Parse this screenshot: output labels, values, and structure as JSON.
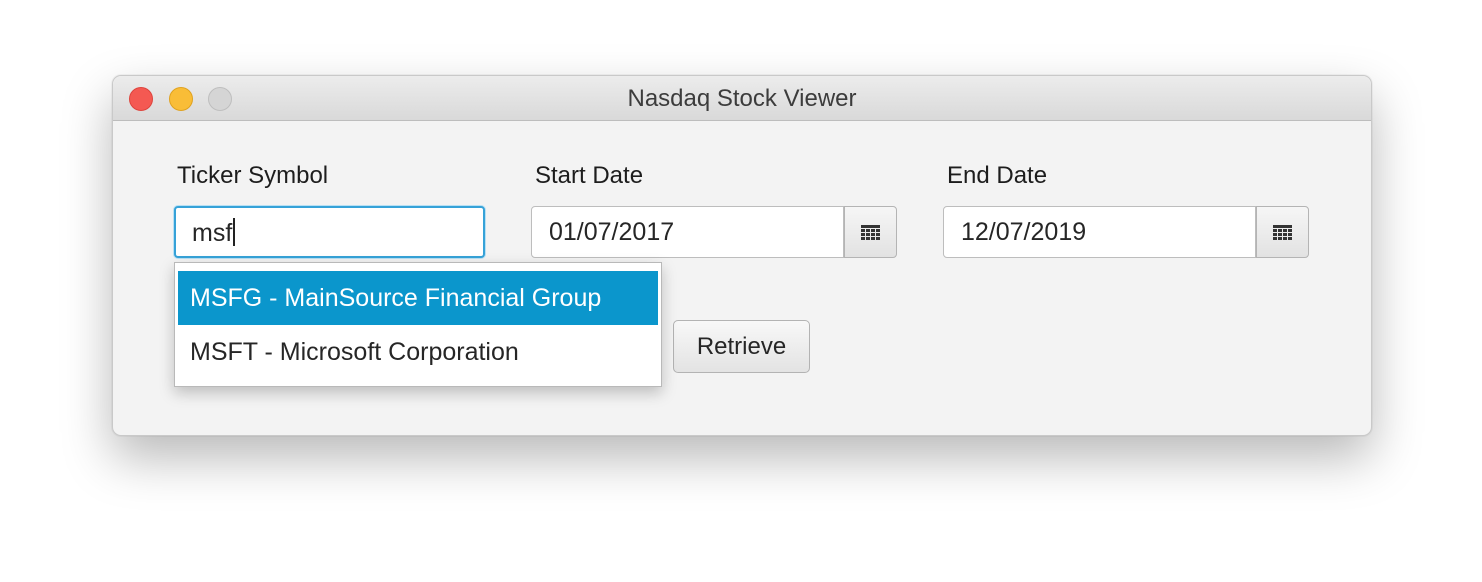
{
  "window": {
    "title": "Nasdaq Stock Viewer"
  },
  "form": {
    "ticker": {
      "label": "Ticker Symbol",
      "value": "msf"
    },
    "start_date": {
      "label": "Start Date",
      "value": "01/07/2017"
    },
    "end_date": {
      "label": "End Date",
      "value": "12/07/2019"
    },
    "retrieve_label": "Retrieve"
  },
  "autocomplete": {
    "items": [
      {
        "label": "MSFG - MainSource Financial Group",
        "selected": true
      },
      {
        "label": "MSFT - Microsoft Corporation",
        "selected": false
      }
    ]
  },
  "icons": {
    "calendar": "calendar-icon"
  },
  "colors": {
    "selection": "#0b96cc",
    "focus_ring": "#36a2d8",
    "close_button": "#f45952",
    "minimize_button": "#f9bd37",
    "zoom_button": "#d5d5d5"
  }
}
